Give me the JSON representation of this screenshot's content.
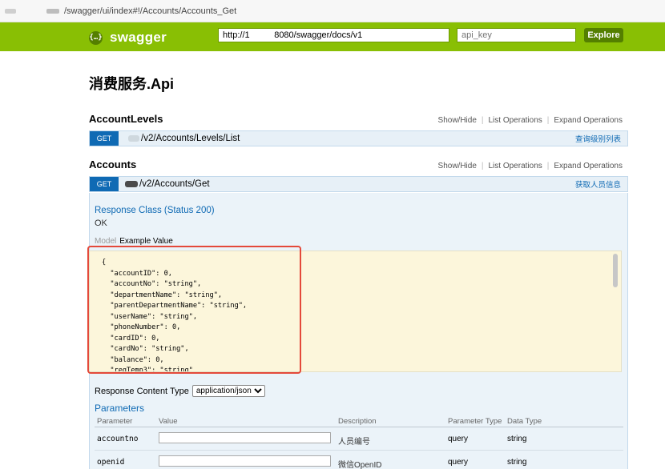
{
  "browser": {
    "url": "/swagger/ui/index#!/Accounts/Accounts_Get"
  },
  "header": {
    "logo_mark": "{…}",
    "logo_text": "swagger",
    "url_value": "http://1          8080/swagger/docs/v1",
    "api_key_placeholder": "api_key",
    "explore_label": "Explore",
    "brand_color": "#89bf04"
  },
  "api": {
    "title": "消费服务.Api"
  },
  "resources": [
    {
      "name": "AccountLevels",
      "links": [
        "Show/Hide",
        "List Operations",
        "Expand Operations"
      ],
      "operation": {
        "method": "GET",
        "path": "/v2/Accounts/Levels/List",
        "summary": "查询级别列表"
      }
    },
    {
      "name": "Accounts",
      "links": [
        "Show/Hide",
        "List Operations",
        "Expand Operations"
      ],
      "operation": {
        "method": "GET",
        "path": "/v2/Accounts/Get",
        "summary": "获取人员信息"
      }
    }
  ],
  "operation_detail": {
    "response_class": "Response Class (Status 200)",
    "response_text": "OK",
    "tab_model": "Model",
    "tab_example": "Example Value",
    "example_json": "{\n  \"accountID\": 0,\n  \"accountNo\": \"string\",\n  \"departmentName\": \"string\",\n  \"parentDepartmentName\": \"string\",\n  \"userName\": \"string\",\n  \"phoneNumber\": 0,\n  \"cardID\": 0,\n  \"cardNo\": \"string\",\n  \"balance\": 0,\n  \"regTemp3\": \"string\"",
    "response_content_type_label": "Response Content Type",
    "response_content_type": "application/json",
    "parameters_title": "Parameters",
    "param_headers": [
      "Parameter",
      "Value",
      "Description",
      "Parameter Type",
      "Data Type"
    ],
    "params": [
      {
        "name": "accountno",
        "value": "",
        "description": "人员编号",
        "param_type": "query",
        "data_type": "string"
      },
      {
        "name": "openid",
        "value": "",
        "description": "微信OpenID",
        "param_type": "query",
        "data_type": "string"
      }
    ]
  }
}
